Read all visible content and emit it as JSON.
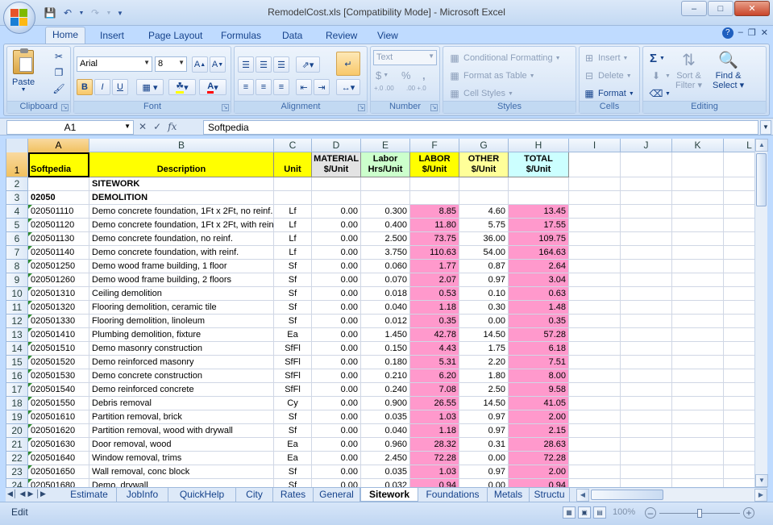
{
  "window": {
    "title": "RemodelCost.xls  [Compatibility Mode] - Microsoft Excel"
  },
  "ribbon_tabs": [
    "Home",
    "Insert",
    "Page Layout",
    "Formulas",
    "Data",
    "Review",
    "View"
  ],
  "ribbon": {
    "clipboard": {
      "label": "Clipboard",
      "paste": "Paste"
    },
    "font": {
      "label": "Font",
      "name": "Arial",
      "size": "8"
    },
    "alignment": {
      "label": "Alignment"
    },
    "number": {
      "label": "Number",
      "format": "Text",
      "currency": "$",
      "percent": "%",
      "comma": ",",
      "inc_decimal": "+.0 .00",
      "dec_decimal": ".00 +.0"
    },
    "styles": {
      "label": "Styles",
      "conditional": "Conditional Formatting",
      "table": "Format as Table",
      "cell_styles": "Cell Styles"
    },
    "cells": {
      "label": "Cells",
      "insert": "Insert",
      "delete": "Delete",
      "format": "Format"
    },
    "editing": {
      "label": "Editing",
      "sum": "Σ",
      "sort": "Sort &",
      "filter": "Filter",
      "find": "Find &",
      "select": "Select"
    }
  },
  "formula_bar": {
    "name_box": "A1",
    "value": "Softpedia",
    "fx": "fx"
  },
  "columns": [
    "A",
    "B",
    "C",
    "D",
    "E",
    "F",
    "G",
    "H",
    "I",
    "J",
    "K",
    "L"
  ],
  "header_row": {
    "A": "Softpedia",
    "B": "Description",
    "C": "Unit",
    "D": "MATERIAL $/Unit",
    "E": "Labor Hrs/Unit",
    "F": "LABOR $/Unit",
    "G": "OTHER $/Unit",
    "H": "TOTAL $/Unit"
  },
  "section_rows": [
    {
      "row": "2",
      "a": "",
      "b": "SITEWORK"
    },
    {
      "row": "3",
      "a": "02050",
      "b": "DEMOLITION"
    }
  ],
  "rows": [
    {
      "row": "4",
      "code": "020501110",
      "desc": "Demo concrete foundation, 1Ft x 2Ft, no reinf.",
      "unit": "Lf",
      "material": "0.00",
      "hrs": "0.300",
      "labor": "8.85",
      "other": "4.60",
      "total": "13.45"
    },
    {
      "row": "5",
      "code": "020501120",
      "desc": "Demo concrete foundation, 1Ft x 2Ft, with reinf",
      "unit": "Lf",
      "material": "0.00",
      "hrs": "0.400",
      "labor": "11.80",
      "other": "5.75",
      "total": "17.55"
    },
    {
      "row": "6",
      "code": "020501130",
      "desc": "Demo concrete foundation, no reinf.",
      "unit": "Lf",
      "material": "0.00",
      "hrs": "2.500",
      "labor": "73.75",
      "other": "36.00",
      "total": "109.75"
    },
    {
      "row": "7",
      "code": "020501140",
      "desc": "Demo concrete foundation, with reinf.",
      "unit": "Lf",
      "material": "0.00",
      "hrs": "3.750",
      "labor": "110.63",
      "other": "54.00",
      "total": "164.63"
    },
    {
      "row": "8",
      "code": "020501250",
      "desc": "Demo wood frame building, 1 floor",
      "unit": "Sf",
      "material": "0.00",
      "hrs": "0.060",
      "labor": "1.77",
      "other": "0.87",
      "total": "2.64"
    },
    {
      "row": "9",
      "code": "020501260",
      "desc": "Demo wood frame building, 2 floors",
      "unit": "Sf",
      "material": "0.00",
      "hrs": "0.070",
      "labor": "2.07",
      "other": "0.97",
      "total": "3.04"
    },
    {
      "row": "10",
      "code": "020501310",
      "desc": "Ceiling demolition",
      "unit": "Sf",
      "material": "0.00",
      "hrs": "0.018",
      "labor": "0.53",
      "other": "0.10",
      "total": "0.63"
    },
    {
      "row": "11",
      "code": "020501320",
      "desc": "Flooring demolition, ceramic tile",
      "unit": "Sf",
      "material": "0.00",
      "hrs": "0.040",
      "labor": "1.18",
      "other": "0.30",
      "total": "1.48"
    },
    {
      "row": "12",
      "code": "020501330",
      "desc": "Flooring demolition, linoleum",
      "unit": "Sf",
      "material": "0.00",
      "hrs": "0.012",
      "labor": "0.35",
      "other": "0.00",
      "total": "0.35"
    },
    {
      "row": "13",
      "code": "020501410",
      "desc": "Plumbing demolition, fixture",
      "unit": "Ea",
      "material": "0.00",
      "hrs": "1.450",
      "labor": "42.78",
      "other": "14.50",
      "total": "57.28"
    },
    {
      "row": "14",
      "code": "020501510",
      "desc": "Demo masonry construction",
      "unit": "SfFl",
      "material": "0.00",
      "hrs": "0.150",
      "labor": "4.43",
      "other": "1.75",
      "total": "6.18"
    },
    {
      "row": "15",
      "code": "020501520",
      "desc": "Demo reinforced masonry",
      "unit": "SfFl",
      "material": "0.00",
      "hrs": "0.180",
      "labor": "5.31",
      "other": "2.20",
      "total": "7.51"
    },
    {
      "row": "16",
      "code": "020501530",
      "desc": "Demo concrete construction",
      "unit": "SfFl",
      "material": "0.00",
      "hrs": "0.210",
      "labor": "6.20",
      "other": "1.80",
      "total": "8.00"
    },
    {
      "row": "17",
      "code": "020501540",
      "desc": "Demo reinforced concrete",
      "unit": "SfFl",
      "material": "0.00",
      "hrs": "0.240",
      "labor": "7.08",
      "other": "2.50",
      "total": "9.58"
    },
    {
      "row": "18",
      "code": "020501550",
      "desc": "Debris removal",
      "unit": "Cy",
      "material": "0.00",
      "hrs": "0.900",
      "labor": "26.55",
      "other": "14.50",
      "total": "41.05"
    },
    {
      "row": "19",
      "code": "020501610",
      "desc": "Partition removal, brick",
      "unit": "Sf",
      "material": "0.00",
      "hrs": "0.035",
      "labor": "1.03",
      "other": "0.97",
      "total": "2.00"
    },
    {
      "row": "20",
      "code": "020501620",
      "desc": "Partition removal, wood with drywall",
      "unit": "Sf",
      "material": "0.00",
      "hrs": "0.040",
      "labor": "1.18",
      "other": "0.97",
      "total": "2.15"
    },
    {
      "row": "21",
      "code": "020501630",
      "desc": "Door removal, wood",
      "unit": "Ea",
      "material": "0.00",
      "hrs": "0.960",
      "labor": "28.32",
      "other": "0.31",
      "total": "28.63"
    },
    {
      "row": "22",
      "code": "020501640",
      "desc": "Window removal, trims",
      "unit": "Ea",
      "material": "0.00",
      "hrs": "2.450",
      "labor": "72.28",
      "other": "0.00",
      "total": "72.28"
    },
    {
      "row": "23",
      "code": "020501650",
      "desc": "Wall removal, conc block",
      "unit": "Sf",
      "material": "0.00",
      "hrs": "0.035",
      "labor": "1.03",
      "other": "0.97",
      "total": "2.00"
    },
    {
      "row": "24",
      "code": "020501680",
      "desc": "Demo. drywall",
      "unit": "Sf",
      "material": "0.00",
      "hrs": "0.032",
      "labor": "0.94",
      "other": "0.00",
      "total": "0.94"
    }
  ],
  "row1_label": "1",
  "sheet_tabs": [
    "Estimate",
    "JobInfo",
    "QuickHelp",
    "City",
    "Rates",
    "General",
    "Sitework",
    "Foundations",
    "Metals",
    "Structu"
  ],
  "active_sheet": "Sitework",
  "status": {
    "mode": "Edit",
    "zoom": "100%"
  },
  "colors": {
    "header_yellow": "#ffff00",
    "labor_header_green": "#ccffcc",
    "material_header_gray": "#e3e3e3",
    "other_header_yellow": "#ffff99",
    "total_header_cyan": "#ccffff",
    "pink_cells": "#ff99cc"
  }
}
